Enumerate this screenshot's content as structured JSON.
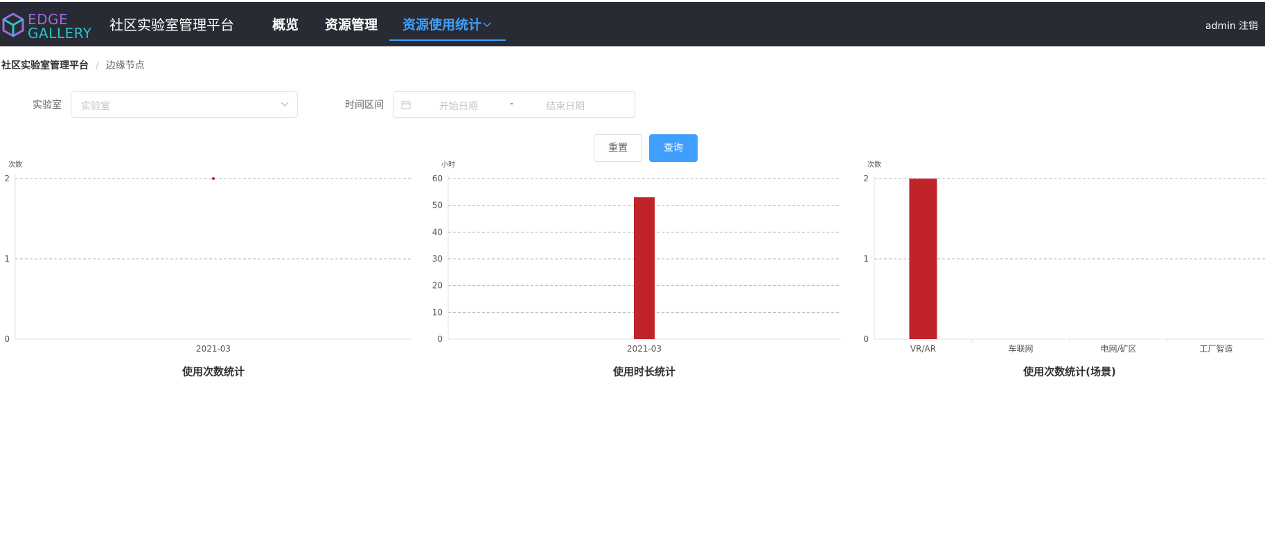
{
  "header": {
    "logo_top": "EDGE",
    "logo_bottom": "GALLERY",
    "platform_title": "社区实验室管理平台",
    "nav": [
      "概览",
      "资源管理",
      "资源使用统计"
    ],
    "active_nav": "资源使用统计",
    "user": "admin",
    "logout": "注销"
  },
  "breadcrumb": [
    "社区实验室管理平台",
    "边缘节点"
  ],
  "breadcrumb_sep": "/",
  "filters": {
    "lab_label": "实验室",
    "lab_placeholder": "实验室",
    "range_label": "时间区间",
    "start_placeholder": "开始日期",
    "range_separator": "-",
    "end_placeholder": "结束日期",
    "reset_label": "重置",
    "query_label": "查询"
  },
  "colors": {
    "bar": "#c1232b",
    "accent": "#409eff",
    "header_bg": "#282b33"
  },
  "chart_data": [
    {
      "type": "line",
      "title": "使用次数统计",
      "ylabel": "次数",
      "categories": [
        "2021-03"
      ],
      "values": [
        2
      ],
      "ylim": [
        0,
        2
      ],
      "yticks": [
        0,
        1,
        2
      ],
      "grid": true
    },
    {
      "type": "bar",
      "title": "使用时长统计",
      "ylabel": "小时",
      "categories": [
        "2021-03"
      ],
      "values": [
        53
      ],
      "ylim": [
        0,
        60
      ],
      "yticks": [
        0,
        10,
        20,
        30,
        40,
        50,
        60
      ],
      "grid": true
    },
    {
      "type": "bar",
      "title": "使用次数统计(场景)",
      "ylabel": "次数",
      "categories": [
        "VR/AR",
        "车联网",
        "电网/矿区",
        "工厂智造"
      ],
      "values": [
        2,
        0,
        0,
        0
      ],
      "ylim": [
        0,
        2
      ],
      "yticks": [
        0,
        1,
        2
      ],
      "grid": true
    }
  ]
}
